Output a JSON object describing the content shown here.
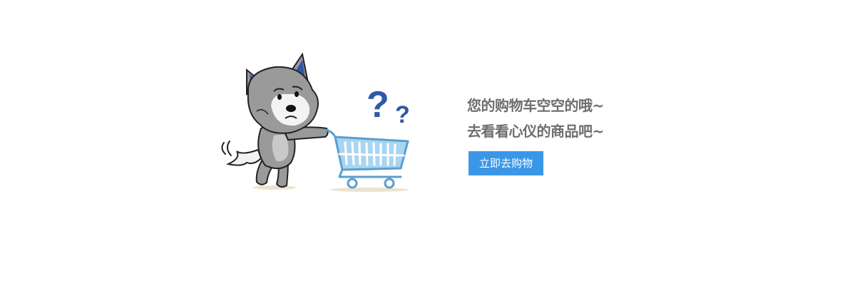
{
  "empty_cart": {
    "message_line_1": "您的购物车空空的哦~",
    "message_line_2": "去看看心仪的商品吧~",
    "button_label": "立即去购物"
  },
  "illustration": {
    "character": "wolf-pushing-cart",
    "icons": [
      "question-mark-icon",
      "shopping-cart-icon"
    ]
  },
  "colors": {
    "button_bg": "#3a97e8",
    "text": "#6e6e6e",
    "question_mark": "#2f59a6",
    "cart": "#8ec7ea",
    "wolf_body": "#9a9a9a"
  }
}
